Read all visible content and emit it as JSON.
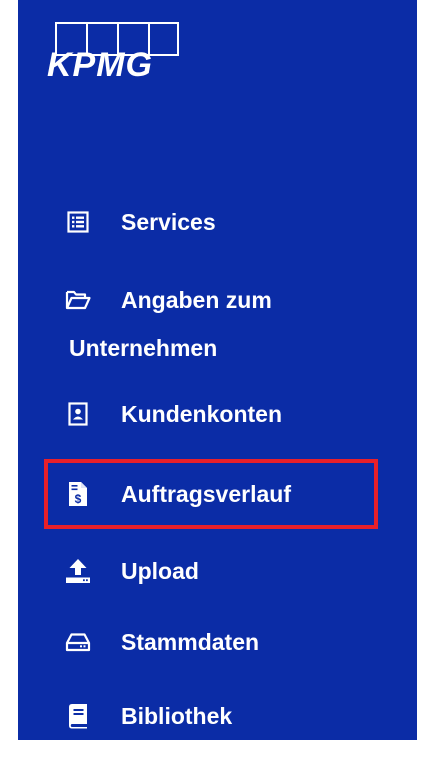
{
  "brand": {
    "logo_text": "KPMG",
    "background_color": "#0b2ca6",
    "highlight_color": "#e8202a"
  },
  "nav": {
    "items": [
      {
        "label": "Services",
        "icon": "list-icon"
      },
      {
        "label": "Angaben zum",
        "label_line2": "Unternehmen",
        "icon": "folder-open-icon"
      },
      {
        "label": "Kundenkonten",
        "icon": "contact-card-icon"
      },
      {
        "label": "Auftragsverlauf",
        "icon": "invoice-icon",
        "highlighted": true
      },
      {
        "label": "Upload",
        "icon": "upload-icon"
      },
      {
        "label": "Stammdaten",
        "icon": "drive-icon"
      },
      {
        "label": "Bibliothek",
        "icon": "book-icon"
      }
    ]
  }
}
